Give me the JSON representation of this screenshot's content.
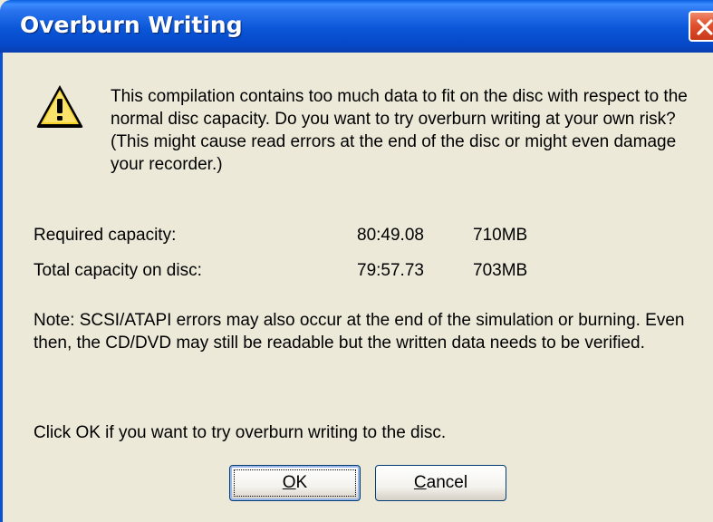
{
  "window": {
    "title": "Overburn Writing"
  },
  "icons": {
    "warning": "warning-icon",
    "close": "close-icon"
  },
  "message": "This compilation contains too much data to fit on the disc with respect to the normal disc capacity. Do you want to try overburn writing at your own risk? (This might cause read errors at the end of the disc or might even damage your recorder.)",
  "capacity": [
    {
      "label": "Required capacity:",
      "time": "80:49.08",
      "size": "710MB"
    },
    {
      "label": "Total capacity on disc:",
      "time": "79:57.73",
      "size": "703MB"
    }
  ],
  "note": "Note: SCSI/ATAPI errors may also occur at the end of the simulation or burning. Even then, the CD/DVD may still be readable but the written data needs to be verified.",
  "confirm": "Click OK if you want to try overburn writing to the disc.",
  "buttons": {
    "ok": {
      "access_key": "O",
      "rest": "K"
    },
    "cancel": {
      "access_key": "C",
      "rest": "ancel"
    }
  },
  "colors": {
    "titlebar": "#0a56d8",
    "dialog_bg": "#ece9d8",
    "close": "#e0512e"
  }
}
